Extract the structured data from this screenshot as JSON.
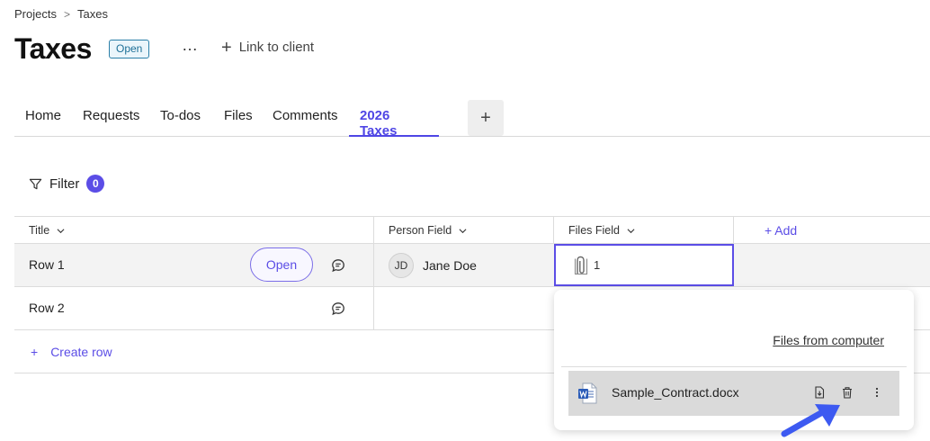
{
  "breadcrumb": {
    "parent": "Projects",
    "separator": ">",
    "current": "Taxes"
  },
  "header": {
    "title": "Taxes",
    "status_badge": "Open",
    "more_label": "…",
    "link_client_label": "Link to client"
  },
  "tabs": [
    {
      "label": "Home"
    },
    {
      "label": "Requests"
    },
    {
      "label": "To-dos"
    },
    {
      "label": "Files"
    },
    {
      "label": "Comments"
    },
    {
      "label": "2026 Taxes",
      "active": true
    }
  ],
  "tab_add_label": "+",
  "filter": {
    "label": "Filter",
    "count": "0"
  },
  "table": {
    "columns": [
      "Title",
      "Person Field",
      "Files Field"
    ],
    "add_column_label": "+ Add",
    "rows": [
      {
        "title": "Row 1",
        "open_label": "Open",
        "person_initials": "JD",
        "person_name": "Jane Doe",
        "files_count": "1"
      },
      {
        "title": "Row 2"
      }
    ],
    "create_row_label": "Create row"
  },
  "popover": {
    "files_from_computer": "Files from computer",
    "file_name": "Sample_Contract.docx"
  },
  "colors": {
    "accent": "#5b4de6",
    "badge": "#1d6f97",
    "arrow": "#3d5af1"
  }
}
